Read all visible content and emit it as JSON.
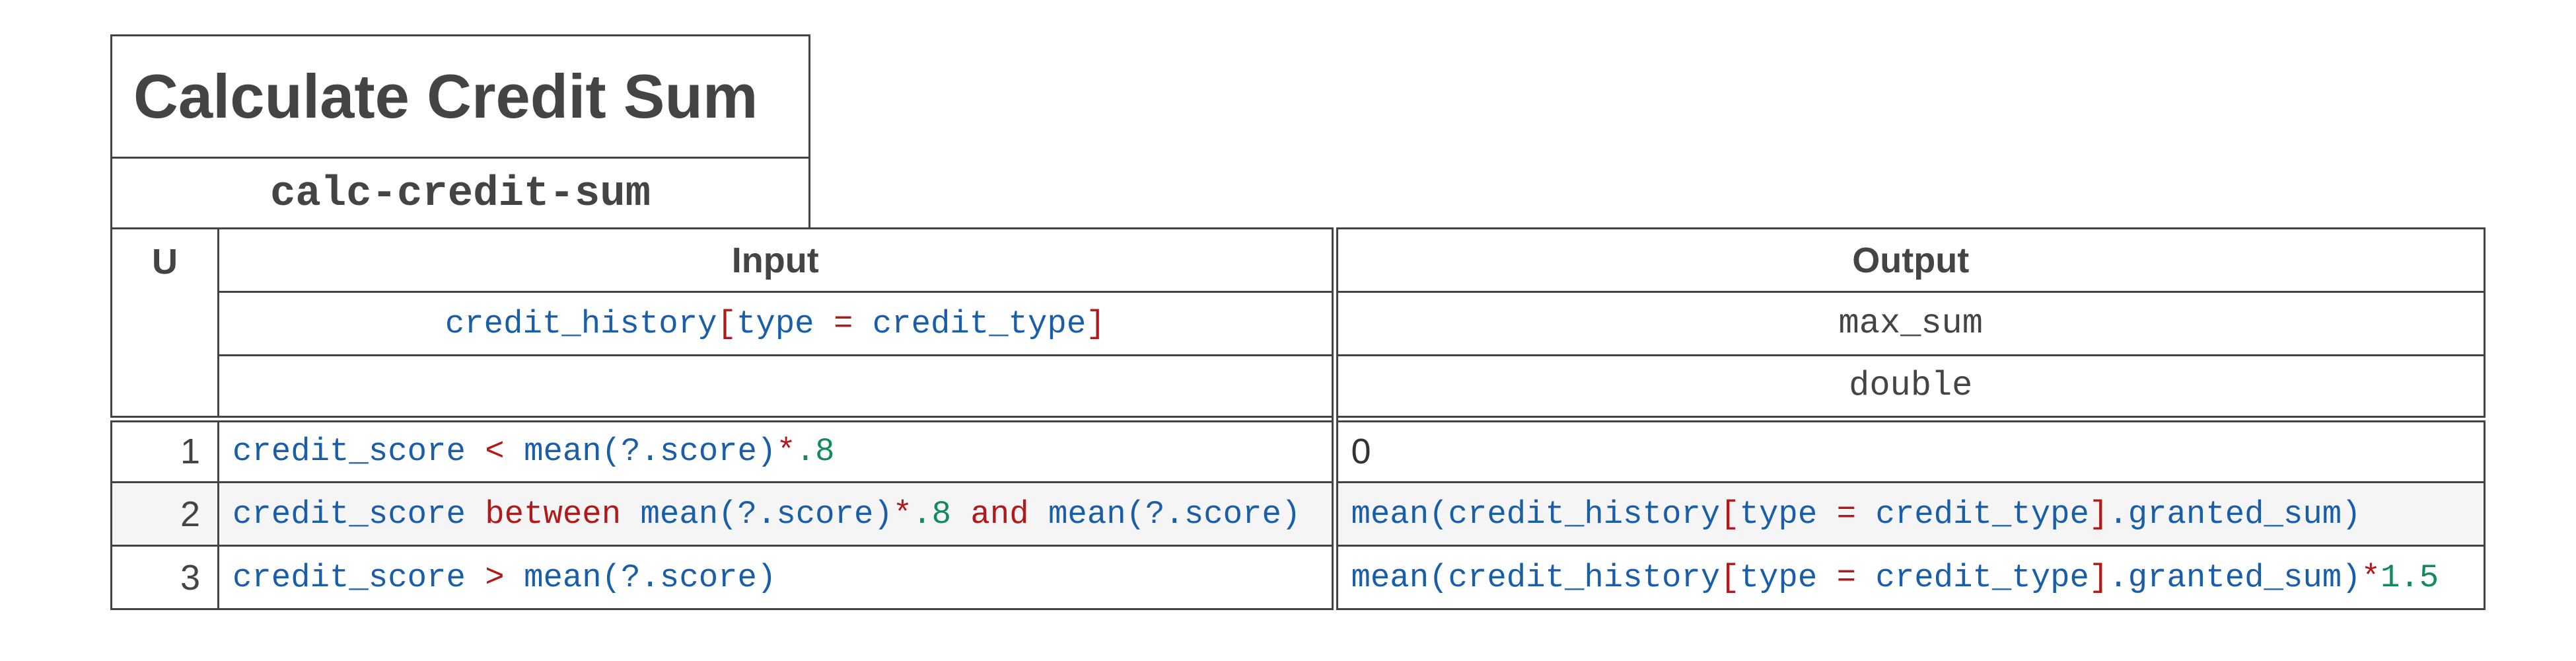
{
  "decision": {
    "title": "Calculate Credit Sum",
    "id": "calc-credit-sum"
  },
  "table": {
    "hit_policy": "U",
    "input_header": "Input",
    "output_header": "Output",
    "input_expression": {
      "collection": "credit_history",
      "open_bracket": "[",
      "filter_left": "type",
      "filter_op": "=",
      "filter_right": "credit_type",
      "close_bracket": "]"
    },
    "output_name": "max_sum",
    "output_type": "double",
    "rules": [
      {
        "number": "1",
        "input": {
          "a": "credit_score",
          "op": "<",
          "b": "mean(?.score)",
          "mul": "*",
          "num": ".8"
        },
        "output": "0"
      },
      {
        "number": "2",
        "input": {
          "a": "credit_score",
          "kw1": "between",
          "b": "mean(?.score)",
          "mul": "*",
          "num": ".8",
          "kw2": "and",
          "c": "mean(?.score)"
        },
        "output": {
          "a": "mean(credit_history",
          "ob": "[",
          "b": "type",
          "op": "=",
          "c": "credit_type",
          "cb": "]",
          "d": ".granted_sum)"
        }
      },
      {
        "number": "3",
        "input": {
          "a": "credit_score",
          "op": ">",
          "b": "mean(?.score)"
        },
        "output": {
          "a": "mean(credit_history",
          "ob": "[",
          "b": "type",
          "op": "=",
          "c": "credit_type",
          "cb": "]",
          "d": ".granted_sum)",
          "mul": "*",
          "num": "1.5"
        }
      }
    ]
  }
}
